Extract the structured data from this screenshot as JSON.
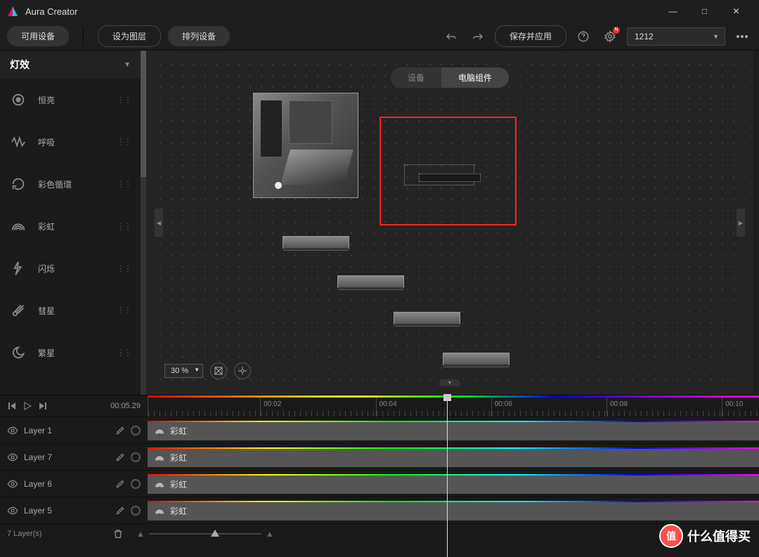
{
  "app": {
    "title": "Aura Creator"
  },
  "window_controls": {
    "min": "—",
    "max": "□",
    "close": "✕"
  },
  "toolbar": {
    "available_devices": "可用设备",
    "set_as_layer": "设为图层",
    "arrange": "排列设备",
    "save_apply": "保存并应用",
    "project_name": "1212",
    "notif_count": "N"
  },
  "sidebar": {
    "header": "灯效",
    "effects": [
      {
        "name": "恒亮"
      },
      {
        "name": "呼吸"
      },
      {
        "name": "彩色循環"
      },
      {
        "name": "彩虹"
      },
      {
        "name": "闪烁"
      },
      {
        "name": "彗星"
      },
      {
        "name": "繁星"
      }
    ]
  },
  "canvas": {
    "tab_device": "设备",
    "tab_component": "电脑组件",
    "zoom_level": "30 %"
  },
  "timeline": {
    "current_time": "00:05.29",
    "marks": [
      "00:02",
      "00:04",
      "00:06",
      "00:08",
      "00:10"
    ],
    "playhead_pct": 49,
    "layers": [
      {
        "name": "Layer 1",
        "clip_effect": "彩虹"
      },
      {
        "name": "Layer 7",
        "clip_effect": "彩虹"
      },
      {
        "name": "Layer 6",
        "clip_effect": "彩虹"
      },
      {
        "name": "Layer 5",
        "clip_effect": "彩虹"
      }
    ],
    "footer_count": "7  Layer(s)"
  },
  "watermark": {
    "badge": "值",
    "text": "什么值得买"
  }
}
